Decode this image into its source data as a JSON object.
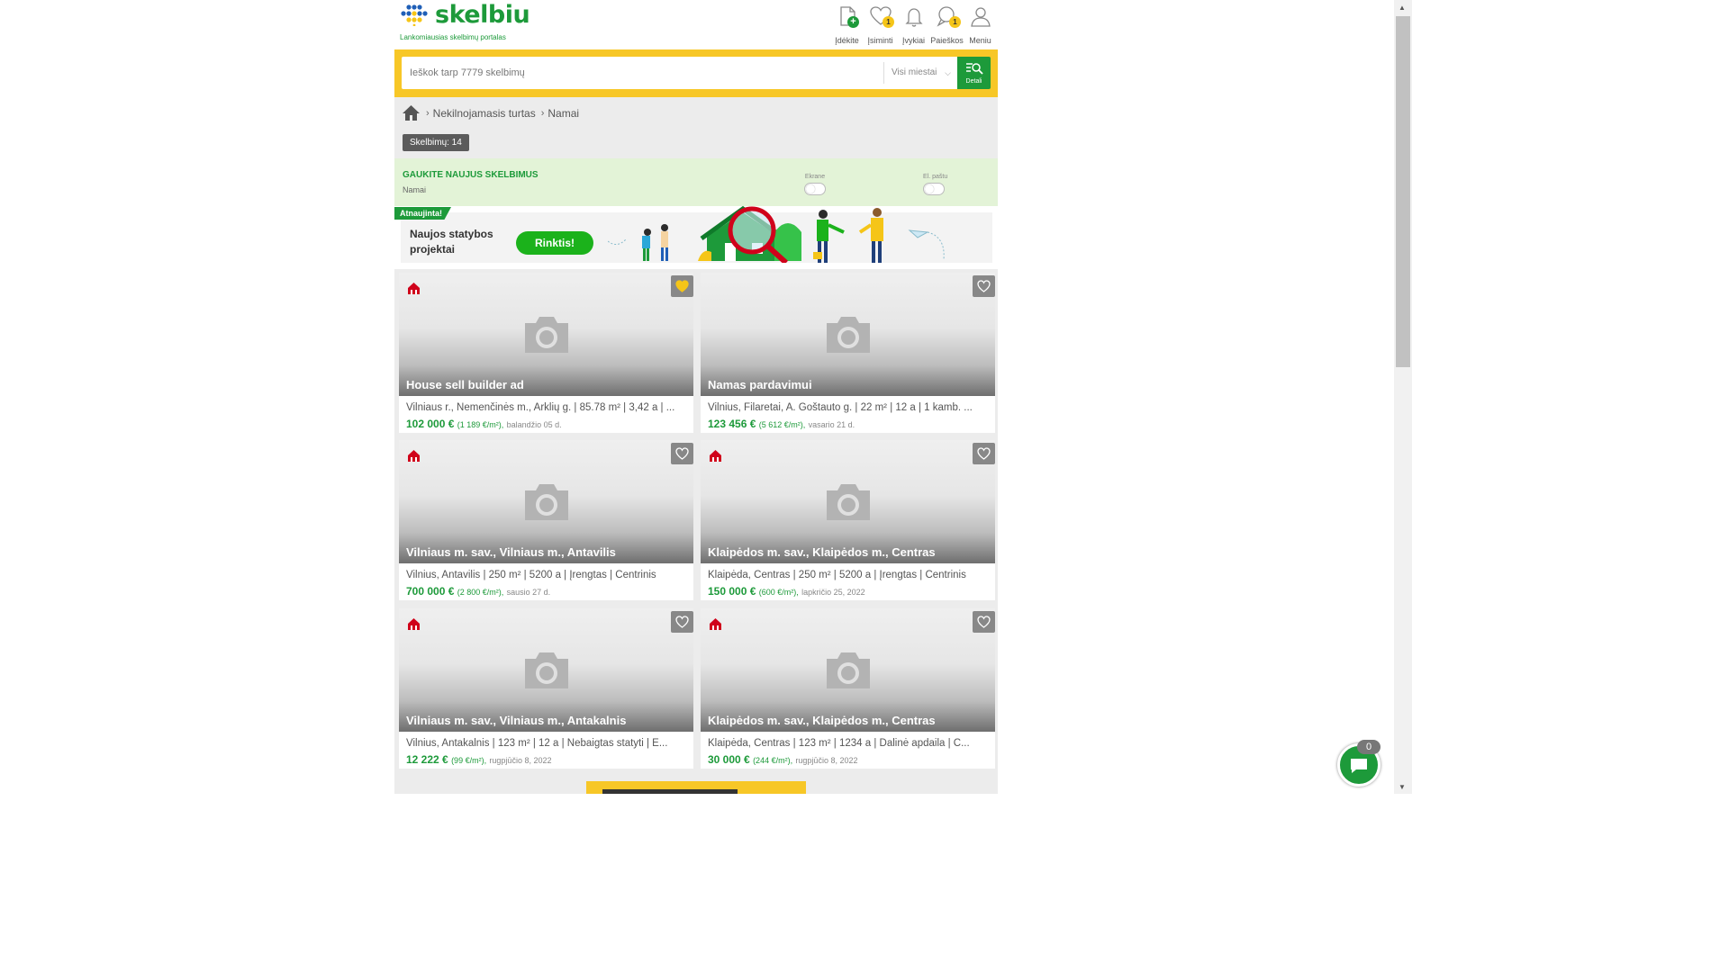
{
  "header": {
    "logo_text": "skelbiu",
    "tagline": "Lankomiausias skelbimų portalas",
    "icons": [
      {
        "label": "Įdėkite",
        "icon": "add-ad-icon",
        "badge": ""
      },
      {
        "label": "Įsiminti",
        "icon": "heart-icon",
        "badge": "1"
      },
      {
        "label": "Įvykiai",
        "icon": "bell-icon",
        "badge": ""
      },
      {
        "label": "Paieškos",
        "icon": "search-bubble-icon",
        "badge": "1"
      },
      {
        "label": "Meniu",
        "icon": "user-icon",
        "badge": ""
      }
    ]
  },
  "search": {
    "placeholder": "Ieškok tarp 7779 skelbimų",
    "city": "Visi miestai",
    "details_label": "Detali"
  },
  "breadcrumb": {
    "items": [
      "Nekilnojamasis turtas",
      "Namai"
    ]
  },
  "count_badge": "Skelbimų: 14",
  "notify": {
    "title": "GAUKITE NAUJUS SKELBIMUS",
    "subtitle": "Namai",
    "screen_label": "Ekrane",
    "email_label": "El. paštu"
  },
  "banner": {
    "tag": "Atnaujinta!",
    "text": "Naujos statybos projektai",
    "button": "Rinktis!"
  },
  "listings": [
    {
      "title": "House sell builder ad",
      "details": "Vilniaus r., Nemenčinės m., Arklių g. | 85.78 m² | 3,42 a | ...",
      "price": "102 000 €",
      "ppm": "(1 189 €/m²),",
      "date": "balandžio 05 d.",
      "favorited": true
    },
    {
      "title": "Namas pardavimui",
      "details": "Vilnius, Filaretai, A. Goštauto g. | 22 m² | 12 a | 1 kamb. ...",
      "price": "123 456 €",
      "ppm": "(5 612 €/m²),",
      "date": "vasario 21 d.",
      "favorited": false
    },
    {
      "title": "Vilniaus m. sav., Vilniaus m., Antavilis",
      "details": "Vilnius, Antavilis | 250 m² | 5200 a | Įrengtas | Centrinis",
      "price": "700 000 €",
      "ppm": "(2 800 €/m²),",
      "date": "sausio 27 d.",
      "favorited": false
    },
    {
      "title": "Klaipėdos m. sav., Klaipėdos m., Centras",
      "details": "Klaipėda, Centras | 250 m² | 5200 a | Įrengtas | Centrinis",
      "price": "150 000 €",
      "ppm": "(600 €/m²),",
      "date": "lapkričio 25, 2022",
      "favorited": false
    },
    {
      "title": "Vilniaus m. sav., Vilniaus m., Antakalnis",
      "details": "Vilnius, Antakalnis | 123 m² | 12 a | Nebaigtas statyti | E...",
      "price": "12 222 €",
      "ppm": "(99 €/m²),",
      "date": "rugpjūčio 8, 2022",
      "favorited": false
    },
    {
      "title": "Klaipėdos m. sav., Klaipėdos m., Centras",
      "details": "Klaipėda, Centras | 123 m² | 1234 a | Dalinė apdaila | C...",
      "price": "30 000 €",
      "ppm": "(244 €/m²),",
      "date": "rugpjūčio 8, 2022",
      "favorited": false
    }
  ],
  "chat": {
    "count": "0"
  },
  "colors": {
    "brand_green": "#1d9a3a",
    "brand_yellow": "#f7c727"
  }
}
